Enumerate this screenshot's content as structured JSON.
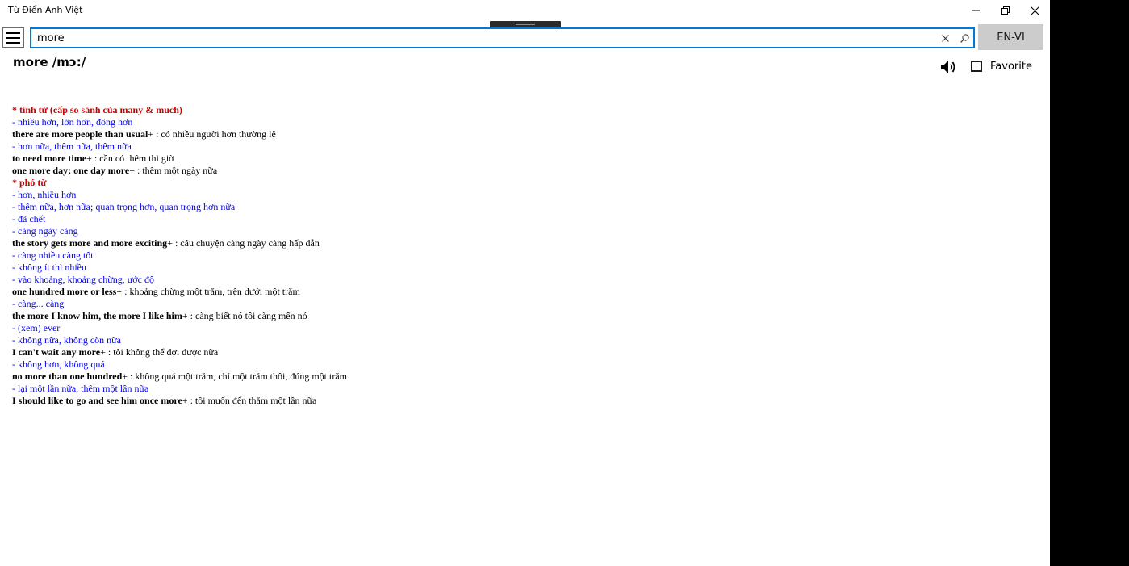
{
  "window": {
    "title": "Từ Điển Anh Việt"
  },
  "search": {
    "value": "more",
    "placeholder": "",
    "direction_label": "EN-VI"
  },
  "entry": {
    "headword": "more /mɔ:/",
    "favorite_label": "Favorite",
    "favorite_checked": false,
    "lines": [
      {
        "kind": "pos",
        "text": "* tính từ (cấp so sánh của many & much)"
      },
      {
        "kind": "meaning",
        "text": "- nhiều hơn, lớn hơn, đông hơn"
      },
      {
        "kind": "example",
        "phrase": "there are more people than usual",
        "translation": "+ : có nhiều người hơn thường lệ"
      },
      {
        "kind": "meaning",
        "text": "- hơn nữa, thêm nữa, thêm nữa"
      },
      {
        "kind": "example",
        "phrase": "to need more time",
        "translation": "+ : cần có thêm thì giờ"
      },
      {
        "kind": "example",
        "phrase": "one more day; one day more",
        "translation": "+ : thêm một ngày nữa"
      },
      {
        "kind": "pos",
        "text": "* phó từ"
      },
      {
        "kind": "meaning",
        "text": "- hơn, nhiều hơn"
      },
      {
        "kind": "meaning",
        "text": "- thêm nữa, hơn nữa; quan trọng hơn, quan trọng hơn nữa"
      },
      {
        "kind": "meaning",
        "text": "- đã chết"
      },
      {
        "kind": "meaning",
        "text": "- càng ngày càng"
      },
      {
        "kind": "example",
        "phrase": "the story gets more and more exciting",
        "translation": "+ : câu chuyện càng ngày càng hấp dẫn"
      },
      {
        "kind": "meaning",
        "text": "- càng nhiều càng tốt"
      },
      {
        "kind": "meaning",
        "text": "- không ít thì nhiều"
      },
      {
        "kind": "meaning",
        "text": "- vào khoảng, khoảng chừng, ước độ"
      },
      {
        "kind": "example",
        "phrase": "one hundred more or less",
        "translation": "+ : khoảng chừng một trăm, trên dưới một trăm"
      },
      {
        "kind": "meaning",
        "text": "- càng... càng"
      },
      {
        "kind": "example",
        "phrase": "the more I know him, the more I like him",
        "translation": "+ : càng biết nó tôi càng mến nó"
      },
      {
        "kind": "meaning",
        "text": "- (xem) ever"
      },
      {
        "kind": "meaning",
        "text": "- không nữa, không còn nữa"
      },
      {
        "kind": "example",
        "phrase": "I can't wait any more",
        "translation": "+ : tôi không thể đợi được nữa"
      },
      {
        "kind": "meaning",
        "text": "- không hơn, không quá"
      },
      {
        "kind": "example",
        "phrase": "no more than one hundred",
        "translation": "+ : không quá một trăm, chỉ một trăm thôi, đúng một trăm"
      },
      {
        "kind": "meaning",
        "text": "- lại một lần nữa, thêm một lần nữa"
      },
      {
        "kind": "example",
        "phrase": "I should like to go and see him once more",
        "translation": "+ : tôi muốn đến thăm một lần nữa"
      }
    ]
  },
  "colors": {
    "accent": "#0078d7",
    "pos": "#cc0000",
    "meaning": "#0000ee",
    "example": "#000000",
    "lang_button_bg": "#cccccc"
  },
  "icons": {
    "menu": "hamburger-icon",
    "clear": "close-icon",
    "search": "search-icon",
    "speaker": "speaker-icon",
    "minimize": "minimize-icon",
    "restore": "restore-icon",
    "close": "close-icon"
  }
}
